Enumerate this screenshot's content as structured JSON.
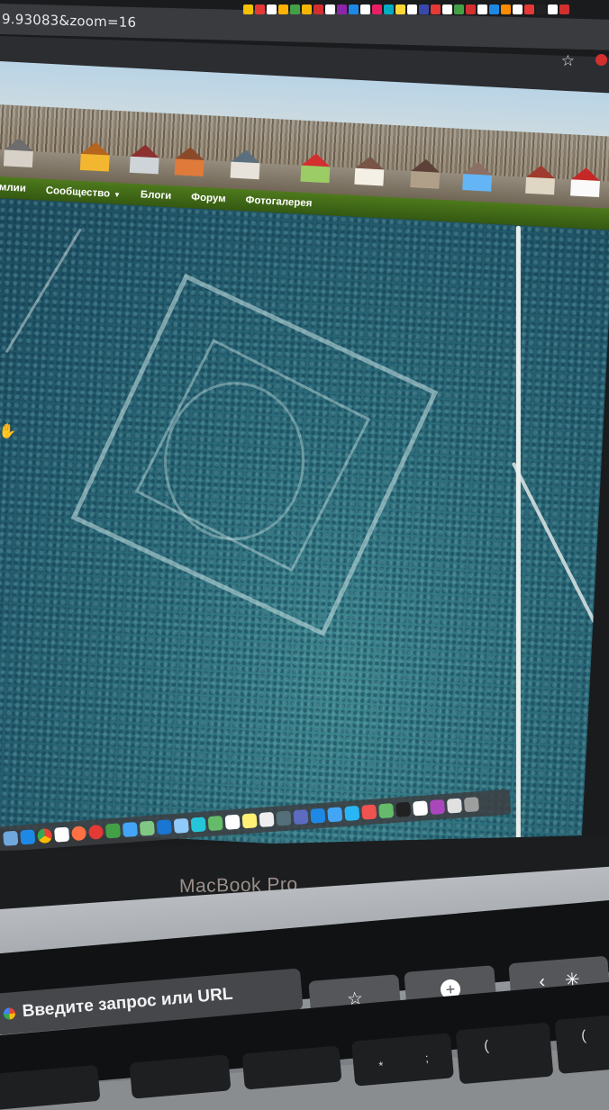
{
  "browser": {
    "url_fragment": "9.93083&zoom=16"
  },
  "site_nav": {
    "items": [
      {
        "label": "емлии",
        "has_dropdown": false
      },
      {
        "label": "Сообщество",
        "has_dropdown": true
      },
      {
        "label": "Блоги",
        "has_dropdown": false
      },
      {
        "label": "Форум",
        "has_dropdown": false
      },
      {
        "label": "Фотогалерея",
        "has_dropdown": false
      }
    ]
  },
  "laptop": {
    "model_label": "MacBook Pro"
  },
  "touchbar": {
    "search_placeholder": "Введите запрос или URL",
    "bookmark_icon": "star-icon",
    "new_tab_icon": "plus-icon",
    "brightness_icon": "brightness-icon"
  },
  "keyboard": {
    "keys": [
      "*",
      ";",
      "(",
      "("
    ]
  },
  "colors": {
    "nav_green": "#3f6a16",
    "map_teal": "#2c6c7a",
    "bezel": "#1a1b1d"
  }
}
